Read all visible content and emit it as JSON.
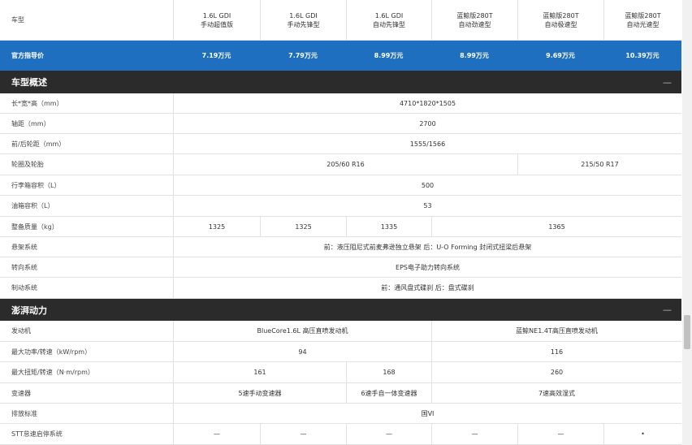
{
  "header": {
    "label": "车型",
    "models": [
      {
        "line1": "1.6L GDI",
        "line2": "手动超值版"
      },
      {
        "line1": "1.6L GDI",
        "line2": "手动先锋型"
      },
      {
        "line1": "1.6L GDI",
        "line2": "自动先锋型"
      },
      {
        "line1": "蓝鲸版280T",
        "line2": "自动劲速型"
      },
      {
        "line1": "蓝鲸版280T",
        "line2": "自动极速型"
      },
      {
        "line1": "蓝鲸版280T",
        "line2": "自动光速型"
      }
    ]
  },
  "price": {
    "label": "官方指导价",
    "values": [
      "7.19万元",
      "7.79万元",
      "8.99万元",
      "8.99万元",
      "9.69万元",
      "10.39万元"
    ]
  },
  "sections": [
    {
      "title": "车型概述",
      "collapse": "—"
    },
    {
      "title": "澎湃动力",
      "collapse": "—"
    }
  ],
  "rows": {
    "dims": {
      "label": "长*宽*高（mm）",
      "v": "4710*1820*1505"
    },
    "wheelbase": {
      "label": "轴距（mm）",
      "v": "2700"
    },
    "track": {
      "label": "前/后轮距（mm）",
      "v": "1555/1566"
    },
    "tires": {
      "label": "轮圈及轮胎",
      "a": "205/60 R16",
      "b": "215/50 R17"
    },
    "trunk": {
      "label": "行李箱容积（L）",
      "v": "500"
    },
    "fuel": {
      "label": "油箱容积（L）",
      "v": "53"
    },
    "weight": {
      "label": "整备质量（kg）",
      "a": "1325",
      "b": "1325",
      "c": "1335",
      "d": "1365"
    },
    "suspension": {
      "label": "悬架系统",
      "v": "前：液压阻尼式前麦弗逊独立悬架 后：U-O Forming 封闭式扭梁后悬架"
    },
    "steering": {
      "label": "转向系统",
      "v": "EPS电子助力转向系统"
    },
    "brake": {
      "label": "制动系统",
      "v": "前：通风盘式碟刹 后：盘式碟刹"
    },
    "engine": {
      "label": "发动机",
      "a": "BlueCore1.6L 高压直喷发动机",
      "b": "蓝鲸NE1.4T高压直喷发动机"
    },
    "power": {
      "label": "最大功率/转速（kW/rpm）",
      "a": "94",
      "b": "116"
    },
    "torque": {
      "label": "最大扭矩/转速（N·m/rpm）",
      "a": "161",
      "b": "168",
      "c": "260"
    },
    "gearbox": {
      "label": "变速器",
      "a": "5速手动变速器",
      "b": "6速手自一体变速器",
      "c": "7速高效湿式"
    },
    "emission": {
      "label": "排放标准",
      "v": "国VI"
    },
    "stt": {
      "label": "STT怠速启停系统",
      "values": [
        "—",
        "—",
        "—",
        "—",
        "—",
        "•"
      ]
    }
  }
}
